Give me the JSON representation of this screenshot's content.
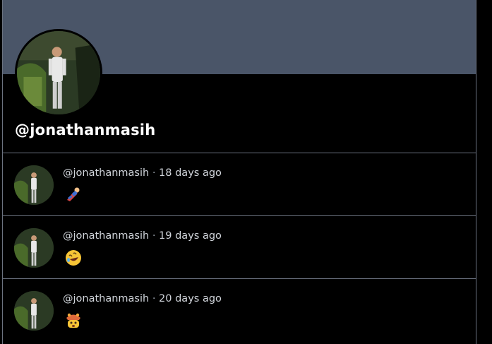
{
  "profile": {
    "handle": "@jonathanmasih"
  },
  "posts": [
    {
      "author": "@jonathanmasih",
      "separator": "·",
      "time": "18 days ago",
      "emoji": "🦸",
      "emoji_icon": "superhero-icon"
    },
    {
      "author": "@jonathanmasih",
      "separator": "·",
      "time": "19 days ago",
      "emoji": "🤣",
      "emoji_icon": "rofl-icon"
    },
    {
      "author": "@jonathanmasih",
      "separator": "·",
      "time": "20 days ago",
      "emoji": "🤯",
      "emoji_icon": "exploding-head-icon"
    }
  ],
  "colors": {
    "banner": "#4a5568",
    "background": "#000000",
    "divider": "#6b7280",
    "meta_text": "#d1d5db"
  }
}
